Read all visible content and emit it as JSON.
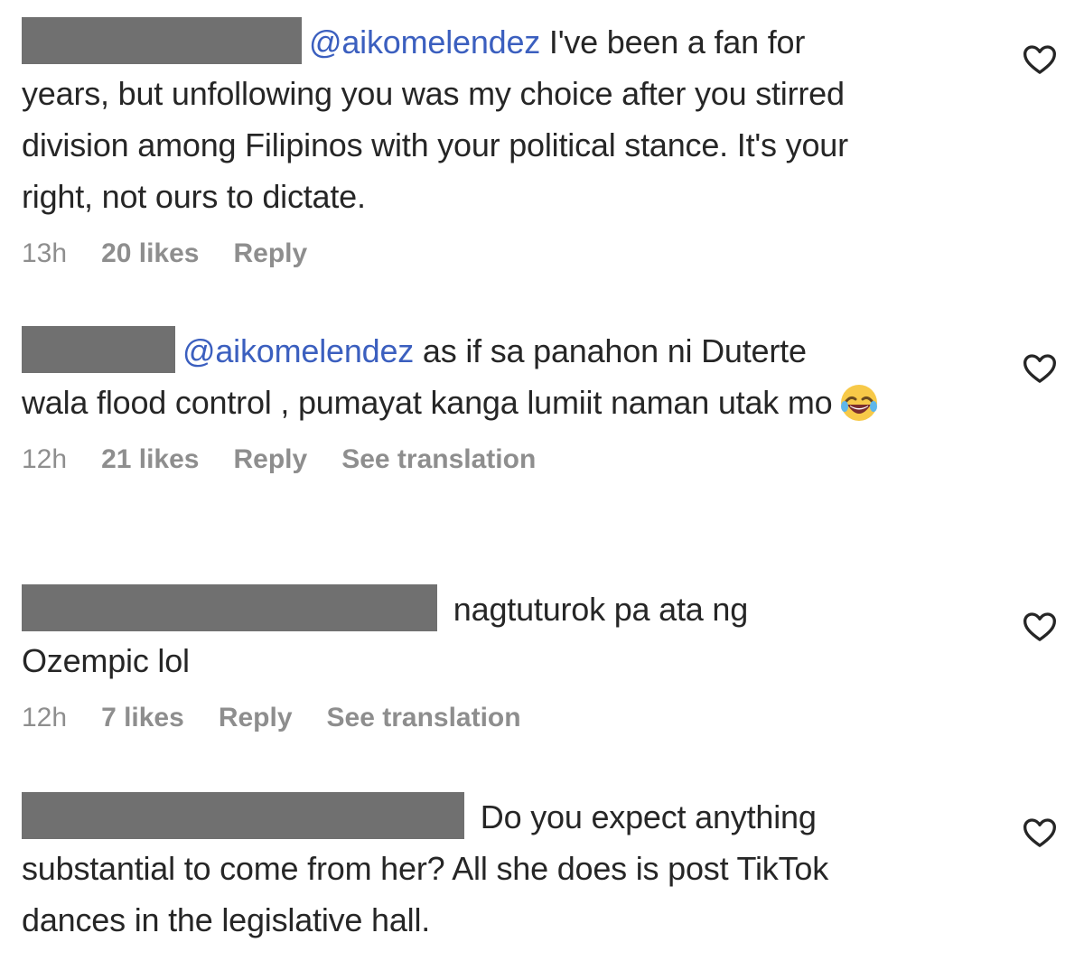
{
  "comments": [
    {
      "mention": "@aikomelendez",
      "text_first": " I've been a fan for",
      "text_rest": "years, but unfollowing you was my choice after you stirred division among Filipinos with your political stance. It's your right, not ours to dictate.",
      "time": "13h",
      "likes": "20 likes",
      "reply": "Reply"
    },
    {
      "mention": "@aikomelendez",
      "text_first": " as if sa panahon ni Duterte",
      "text_rest": "wala flood control , pumayat kanga lumiit naman utak mo",
      "emoji": "rolling-on-floor-laughing-emoji",
      "time": "12h",
      "likes": "21 likes",
      "reply": "Reply",
      "translate": "See translation"
    },
    {
      "text_first": " nagtuturok pa ata ng",
      "text_rest": "Ozempic lol",
      "time": "12h",
      "likes": "7 likes",
      "reply": "Reply",
      "translate": "See translation"
    },
    {
      "text_first": " Do you expect anything",
      "text_rest": "substantial to come from her? All she does is post TikTok dances in the legislative hall."
    }
  ],
  "icons": {
    "like": "heart-icon"
  },
  "colors": {
    "mention": "#3b5fbf",
    "meta": "#8e8e8e",
    "redaction": "#707070",
    "text": "#262626"
  }
}
